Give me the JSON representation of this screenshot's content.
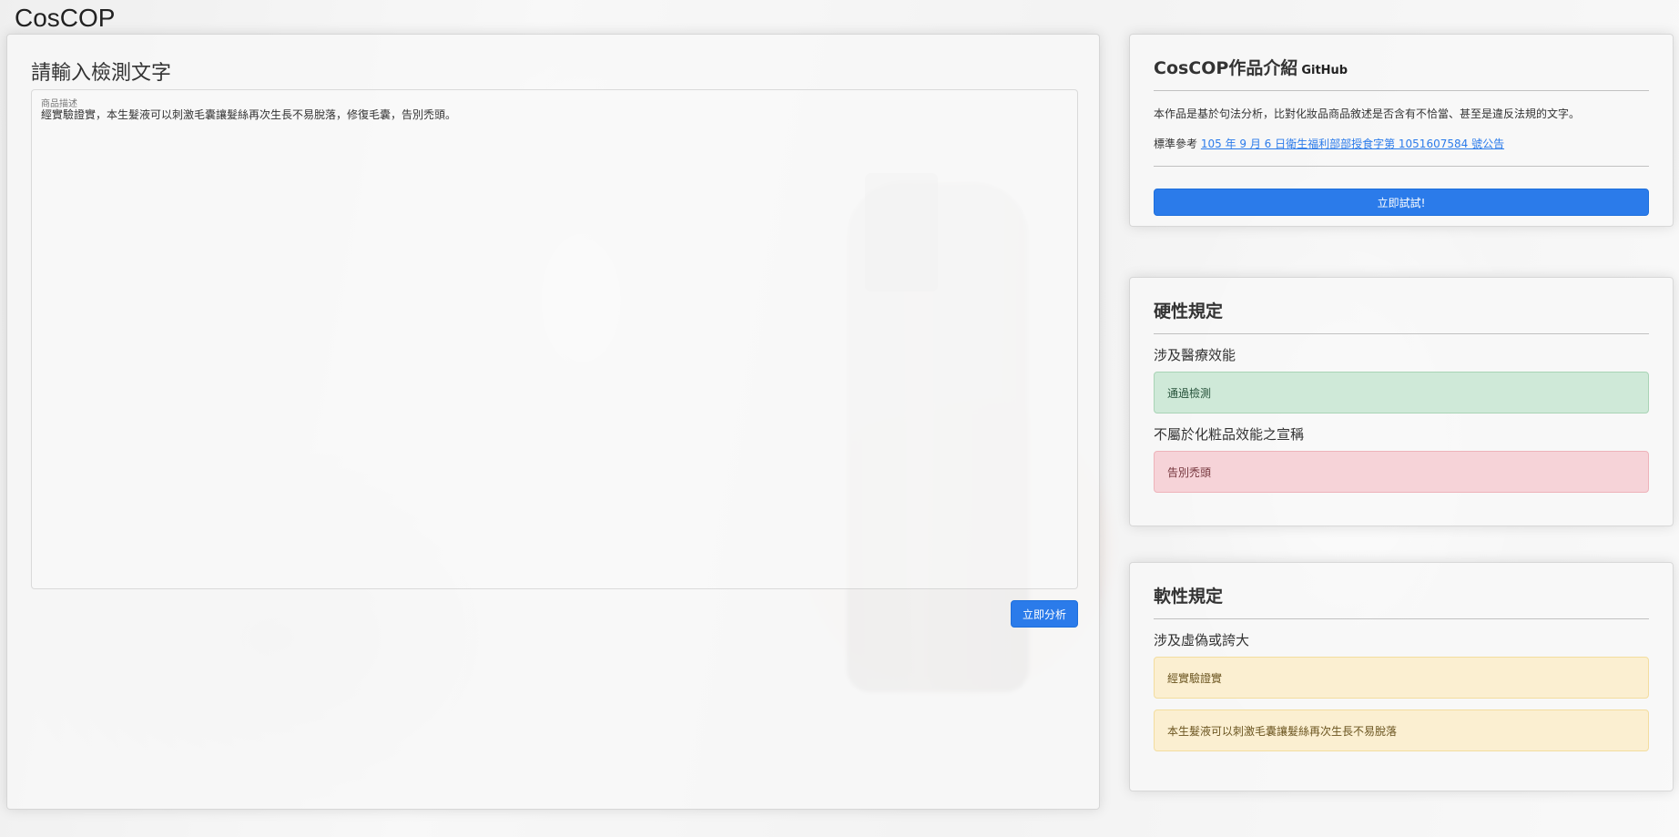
{
  "app": {
    "title": "CosCOP"
  },
  "input": {
    "heading": "請輸入檢測文字",
    "field_label": "商品描述",
    "value": "經實驗證實，本生髮液可以刺激毛囊讓髮絲再次生長不易脫落，修復毛囊，告別禿頭。",
    "analyze_label": "立即分析"
  },
  "intro": {
    "title": "CosCOP作品介紹",
    "github_label": "GitHub",
    "description": "本作品是基於句法分析，比對化妝品商品敘述是否含有不恰當、甚至是違反法規的文字。",
    "ref_prefix": "標準參考",
    "ref_link": "105 年 9 月 6 日衛生福利部部授食字第 1051607584 號公告",
    "try_label": "立即試試!"
  },
  "hard_rules": {
    "title": "硬性規定",
    "groups": [
      {
        "label": "涉及醫療效能",
        "results": [
          "通過檢測"
        ]
      },
      {
        "label": "不屬於化粧品效能之宣稱",
        "results": [
          "告別禿頭"
        ]
      }
    ]
  },
  "soft_rules": {
    "title": "軟性規定",
    "groups": [
      {
        "label": "涉及虛偽或誇大",
        "results": [
          "經實驗證實",
          "本生髮液可以刺激毛囊讓髮絲再次生長不易脫落"
        ]
      }
    ]
  },
  "colors": {
    "primary": "#2b7bea",
    "success_bg": "#c8e6d2",
    "danger_bg": "#f6cdd2",
    "warning_bg": "#fcecc4"
  }
}
